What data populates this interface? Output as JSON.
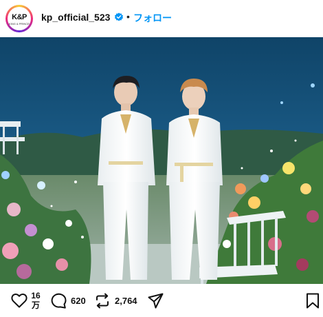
{
  "header": {
    "avatar_logo": "K&P",
    "avatar_sub": "KING & PRINCE",
    "username": "kp_official_523",
    "separator": "•",
    "follow_label": "フォロー"
  },
  "actions": {
    "like_count_top": "16",
    "like_count_bottom": "万",
    "comment_count": "620",
    "repost_count": "2,764"
  },
  "colors": {
    "link_blue": "#0095f6",
    "verified_blue": "#0095f6"
  },
  "icons": [
    "heart-icon",
    "comment-icon",
    "repost-icon",
    "share-icon",
    "bookmark-icon",
    "verified-icon"
  ]
}
